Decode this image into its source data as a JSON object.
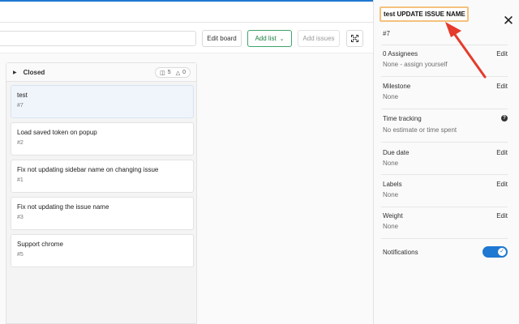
{
  "toolbar": {
    "edit_board_label": "Edit board",
    "add_list_label": "Add list",
    "add_issues_label": "Add issues"
  },
  "list": {
    "title": "Closed",
    "issue_count": "5",
    "weight_count": "0",
    "cards": [
      {
        "title": "test",
        "number": "#7"
      },
      {
        "title": "Load saved token on popup",
        "number": "#2"
      },
      {
        "title": "Fix not updating sidebar name on changing issue",
        "number": "#1"
      },
      {
        "title": "Fix not updating the issue name",
        "number": "#3"
      },
      {
        "title": "Support chrome",
        "number": "#5"
      }
    ]
  },
  "sidebar": {
    "issue_title": "test UPDATE ISSUE NAME",
    "issue_ref": "#7",
    "assignees": {
      "label": "0 Assignees",
      "value": "None - assign yourself",
      "edit": "Edit"
    },
    "milestone": {
      "label": "Milestone",
      "value": "None",
      "edit": "Edit"
    },
    "time_tracking": {
      "label": "Time tracking",
      "value": "No estimate or time spent"
    },
    "due_date": {
      "label": "Due date",
      "value": "None",
      "edit": "Edit"
    },
    "labels": {
      "label": "Labels",
      "value": "None",
      "edit": "Edit"
    },
    "weight": {
      "label": "Weight",
      "value": "None",
      "edit": "Edit"
    },
    "notifications": {
      "label": "Notifications",
      "enabled": true
    }
  },
  "colors": {
    "accent": "#1f78d1",
    "add_list_border": "#3fa46a",
    "title_highlight": "#f4c17c",
    "arrow": "#e53b2c"
  },
  "icons": {
    "close": "close-icon",
    "expand": "fullscreen-icon",
    "help": "question-icon",
    "issues": "issues-icon",
    "weight": "weight-icon",
    "chevron": "chevron-right-icon"
  }
}
